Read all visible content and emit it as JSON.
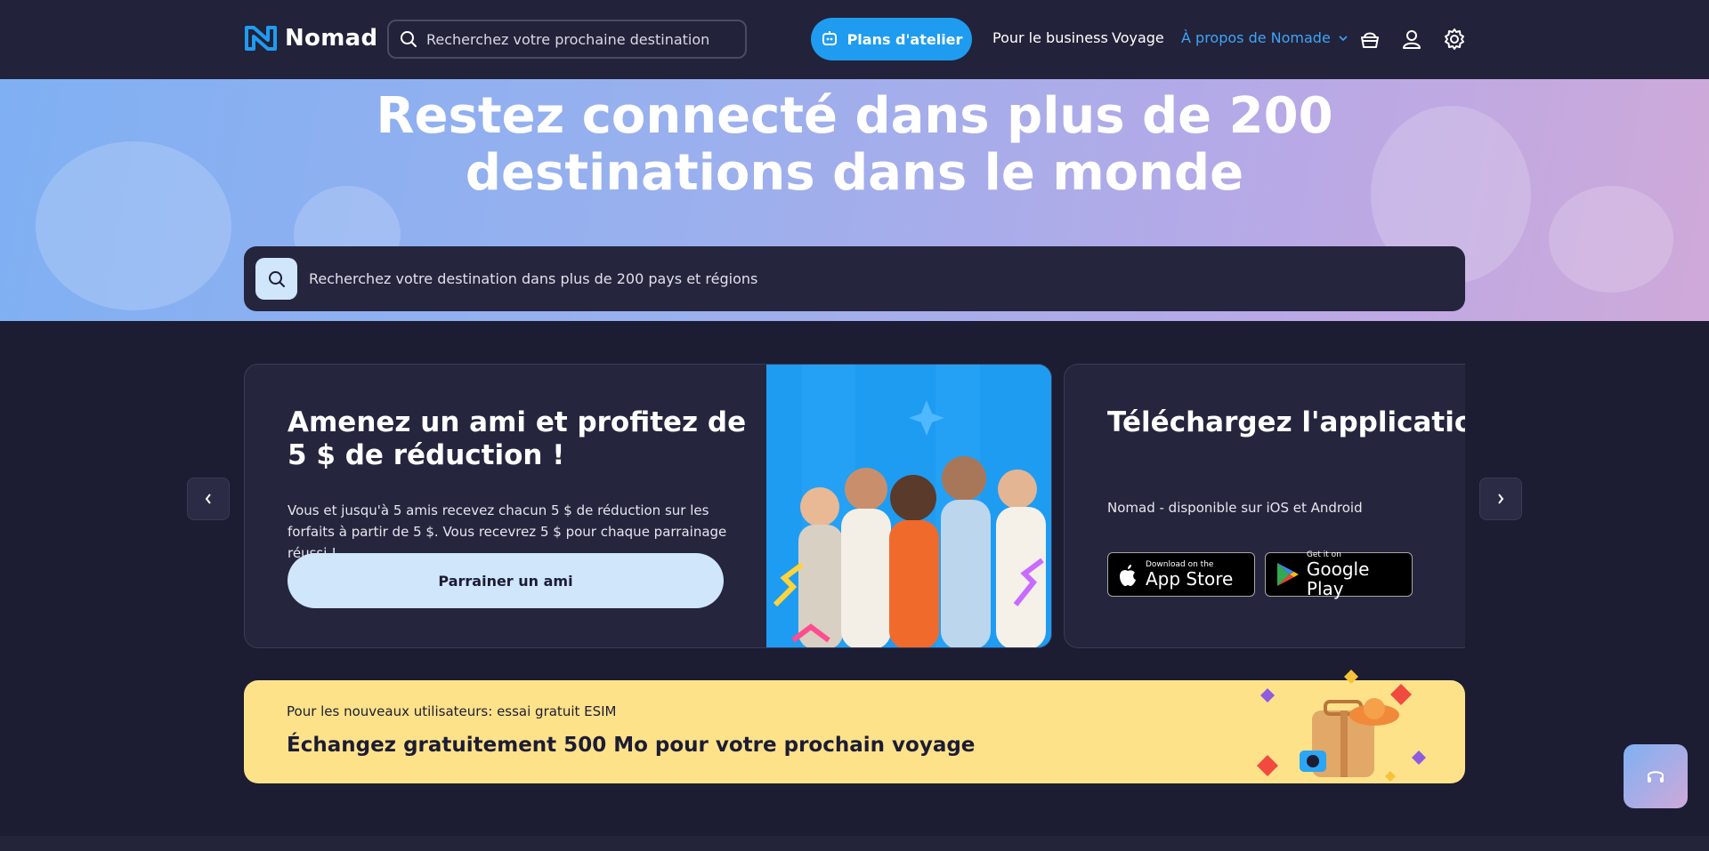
{
  "header": {
    "logo_text": "Nomad",
    "search_placeholder": "Recherchez votre prochaine destination",
    "plans_button": "Plans d'atelier",
    "nav": {
      "business": "Pour le business",
      "travel": "Voyage",
      "about": "À propos de Nomade"
    },
    "icons": [
      "basket-icon",
      "user-icon",
      "settings-icon"
    ]
  },
  "hero": {
    "title": "Restez connecté dans plus de 200 destinations dans le monde",
    "search_placeholder": "Recherchez votre destination dans plus de 200 pays et régions"
  },
  "carousel": {
    "referral": {
      "title": "Amenez un ami et profitez de 5 $ de réduction !",
      "body": "Vous et jusqu'à 5 amis recevez chacun 5 $ de réduction sur les forfaits à partir de 5 $. Vous recevrez 5 $ pour chaque parrainage réussi !",
      "cta": "Parrainer un ami"
    },
    "app": {
      "title": "Téléchargez l'application Nomad",
      "subtitle": "Nomad - disponible sur iOS et Android",
      "app_store_small": "Download on the",
      "app_store_big": "App Store",
      "google_small": "Get it on",
      "google_big": "Google Play"
    }
  },
  "promo": {
    "subtitle": "Pour les nouveaux utilisateurs: essai gratuit ESIM",
    "title": "Échangez gratuitement 500 Mo pour votre prochain voyage"
  },
  "colors": {
    "accent": "#1f9cf0",
    "background": "#1c1c33",
    "promo": "#fee28a"
  }
}
